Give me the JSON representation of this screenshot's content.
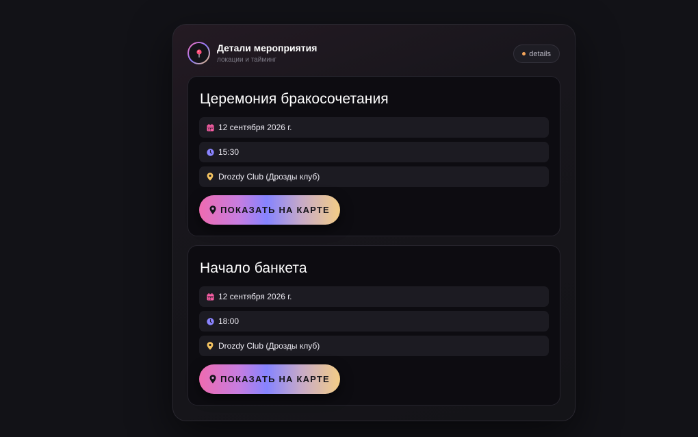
{
  "header": {
    "title": "Детали мероприятия",
    "subtitle": "локации и тайминг",
    "chip_label": "details"
  },
  "events": [
    {
      "title": "Церемония бракосочетания",
      "date": "12 сентября 2026 г.",
      "time": "15:30",
      "location": "Drozdy Club (Дрозды клуб)",
      "button_label": "ПОКАЗАТЬ НА КАРТЕ"
    },
    {
      "title": "Начало банкета",
      "date": "12 сентября 2026 г.",
      "time": "18:00",
      "location": "Drozdy Club (Дрозды клуб)",
      "button_label": "ПОКАЗАТЬ НА КАРТЕ"
    }
  ],
  "icons": {
    "logo": "map-pin-icon",
    "date": "calendar-icon",
    "time": "clock-icon",
    "location": "location-pin-icon",
    "button": "map-pin-icon"
  },
  "colors": {
    "background": "#121217",
    "date_icon": "#ff5fa8",
    "time_icon": "#8a84ff",
    "location_icon": "#f5c461",
    "chip_dot": "#f5a55a",
    "button_gradient": [
      "#ee6bb0",
      "#8684ff",
      "#f3cd86"
    ]
  }
}
